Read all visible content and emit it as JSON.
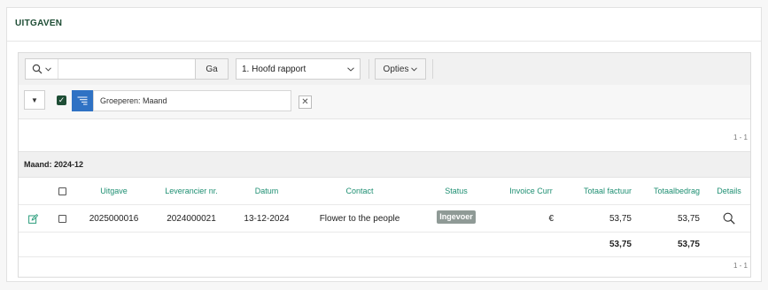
{
  "panel": {
    "title": "UITGAVEN"
  },
  "toolbar": {
    "search_placeholder": "",
    "go_label": "Ga",
    "report_label": "1. Hoofd rapport",
    "options_label": "Opties"
  },
  "filter": {
    "label": "Groeperen: Maand",
    "enabled": true
  },
  "pagination": {
    "top": "1 - 1",
    "bottom": "1 - 1"
  },
  "group": {
    "label": "Maand: 2024-12"
  },
  "table": {
    "columns": [
      "Uitgave",
      "Leverancier nr.",
      "Datum",
      "Contact",
      "Status",
      "Invoice Curr",
      "Totaal factuur",
      "Totaalbedrag",
      "Details"
    ],
    "rows": [
      {
        "uitgave": "2025000016",
        "leverancier": "2024000021",
        "datum": "13-12-2024",
        "contact": "Flower to the people",
        "status": "Ingevoer",
        "currency": "€",
        "totaal_factuur": "53,75",
        "totaalbedrag": "53,75"
      }
    ],
    "totals": {
      "totaal_factuur": "53,75",
      "totaalbedrag": "53,75"
    }
  },
  "icons": {
    "search": "search-icon",
    "edit": "edit-icon",
    "details": "magnifier-icon",
    "filter": "filter-lines-icon",
    "close": "close-icon"
  },
  "colors": {
    "brand_green": "#1e4d35",
    "link_green": "#1e8f72",
    "filter_blue": "#2f72c4",
    "status_gray": "#8f9a96"
  }
}
